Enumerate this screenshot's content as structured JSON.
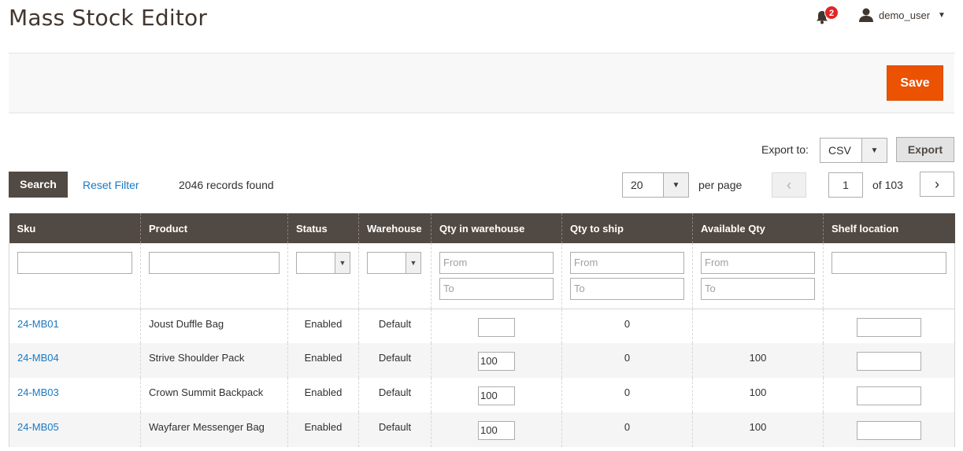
{
  "header": {
    "title": "Mass Stock Editor",
    "notification_count": "2",
    "username": "demo_user"
  },
  "actions": {
    "save_label": "Save"
  },
  "export": {
    "label": "Export to:",
    "format": "CSV",
    "button_label": "Export"
  },
  "toolbar": {
    "search_label": "Search",
    "reset_label": "Reset Filter",
    "records_text": "2046 records found",
    "per_page_value": "20",
    "per_page_label": "per page",
    "current_page": "1",
    "total_pages_text": "of 103"
  },
  "grid": {
    "columns": [
      "Sku",
      "Product",
      "Status",
      "Warehouse",
      "Qty in warehouse",
      "Qty to ship",
      "Available Qty",
      "Shelf location"
    ],
    "filters": {
      "from_placeholder": "From",
      "to_placeholder": "To"
    },
    "rows": [
      {
        "sku": "24-MB01",
        "product": "Joust Duffle Bag",
        "status": "Enabled",
        "warehouse": "Default",
        "qty_warehouse": "",
        "qty_ship": "0",
        "available": "",
        "shelf": ""
      },
      {
        "sku": "24-MB04",
        "product": "Strive Shoulder Pack",
        "status": "Enabled",
        "warehouse": "Default",
        "qty_warehouse": "100",
        "qty_ship": "0",
        "available": "100",
        "shelf": ""
      },
      {
        "sku": "24-MB03",
        "product": "Crown Summit Backpack",
        "status": "Enabled",
        "warehouse": "Default",
        "qty_warehouse": "100",
        "qty_ship": "0",
        "available": "100",
        "shelf": ""
      },
      {
        "sku": "24-MB05",
        "product": "Wayfarer Messenger Bag",
        "status": "Enabled",
        "warehouse": "Default",
        "qty_warehouse": "100",
        "qty_ship": "0",
        "available": "100",
        "shelf": ""
      }
    ]
  },
  "icons": {
    "notification": "bell-icon",
    "user": "user-icon",
    "dropdown": "chevron-down-icon",
    "prev": "chevron-left-icon",
    "next": "chevron-right-icon"
  },
  "colors": {
    "primary": "#eb5202",
    "header_bg": "#514943",
    "link": "#1979c3",
    "badge": "#e22626"
  }
}
